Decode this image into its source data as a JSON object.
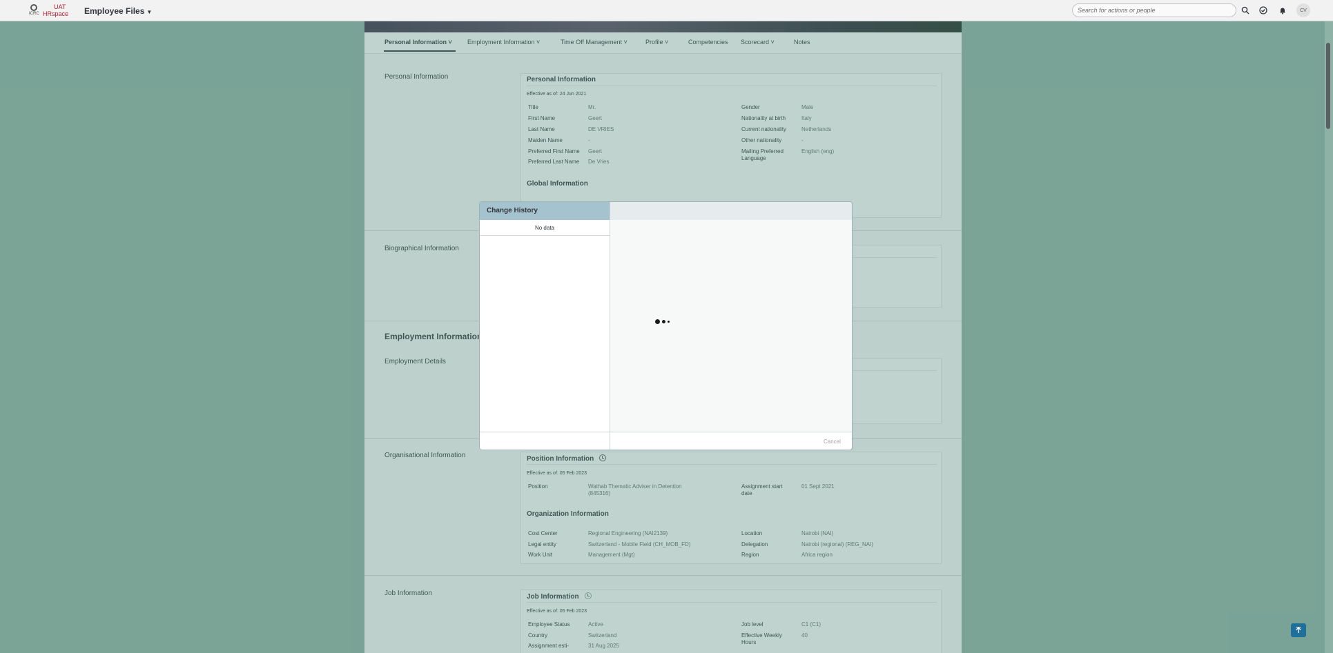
{
  "topbar": {
    "logo": {
      "icrc": "ICRC",
      "uat": "UAT",
      "hr": "HRspace"
    },
    "title": "Employee Files",
    "search_placeholder": "Search for actions or people",
    "avatar_initials": "CV"
  },
  "tabs": [
    {
      "label": "Personal Information",
      "has_menu": true,
      "active": true
    },
    {
      "label": "Employment Information",
      "has_menu": true
    },
    {
      "label": "Time Off Management",
      "has_menu": true
    },
    {
      "label": "Profile",
      "has_menu": true
    },
    {
      "label": "Competencies",
      "has_menu": false
    },
    {
      "label": "Scorecard",
      "has_menu": true
    },
    {
      "label": "Notes",
      "has_menu": false
    }
  ],
  "sections": {
    "personal": "Personal Information",
    "biographical": "Biographical Information",
    "employment_heading": "Employment Information",
    "employment_details": "Employment Details",
    "organisational": "Organisational Information",
    "job": "Job Information"
  },
  "personal_card": {
    "title": "Personal Information",
    "effective": "Effective as of: 24 Jun 2021",
    "left": [
      {
        "label": "Title",
        "value": "Mr."
      },
      {
        "label": "First Name",
        "value": "Geert"
      },
      {
        "label": "Last Name",
        "value": "DE VRIES"
      },
      {
        "label": "Maiden Name",
        "value": "-"
      },
      {
        "label": "Preferred First Name",
        "value": "Geert"
      },
      {
        "label": "Preferred Last Name",
        "value": "De Vries"
      }
    ],
    "right": [
      {
        "label": "Gender",
        "value": "Male"
      },
      {
        "label": "Nationality at birth",
        "value": "Italy"
      },
      {
        "label": "Current nationality",
        "value": "Netherlands"
      },
      {
        "label": "Other nationality",
        "value": "-"
      },
      {
        "label": "Mailing Preferred",
        "label2": "Language",
        "value": "English (eng)"
      }
    ],
    "global_title": "Global Information"
  },
  "position_card": {
    "title": "Position Information",
    "effective": "Effective as of: 05 Feb 2023",
    "position_label": "Position",
    "position_value": "Wathab Thematic Adviser in Detention",
    "position_value2": "(845316)",
    "assign_label": "Assignment start",
    "assign_label2": "date",
    "assign_value": "01 Sept 2021",
    "org_title": "Organization Information",
    "left": [
      {
        "label": "Cost Center",
        "value": "Regional Engineering (NAI2139)"
      },
      {
        "label": "Legal entity",
        "value": "Switzerland - Mobile Field (CH_MOB_FD)"
      },
      {
        "label": "Work Unit",
        "value": "Management (Mgt)"
      }
    ],
    "right": [
      {
        "label": "Location",
        "value": "Nairobi (NAI)"
      },
      {
        "label": "Delegation",
        "value": "Nairobi (regional) (REG_NAI)"
      },
      {
        "label": "Region",
        "value": "Africa region"
      }
    ]
  },
  "job_card": {
    "title": "Job Information",
    "effective": "Effective as of: 05 Feb 2023",
    "left": [
      {
        "label": "Employee Status",
        "value": "Active"
      },
      {
        "label": "Country",
        "value": "Switzerland"
      },
      {
        "label": "Assignment esti-",
        "value": "31 Aug 2025"
      }
    ],
    "right": [
      {
        "label": "Job level",
        "value": "C1 (C1)"
      },
      {
        "label": "Effective Weekly",
        "label2": "Hours",
        "value": "40"
      }
    ]
  },
  "dialog": {
    "title": "Change History",
    "no_data": "No data",
    "cancel": "Cancel",
    "loading": true
  },
  "icons": {
    "search": "search-icon",
    "tasks": "check-circle-icon",
    "notifications": "bell-icon",
    "history": "history-icon",
    "scroll_top": "arrow-up-icon"
  }
}
